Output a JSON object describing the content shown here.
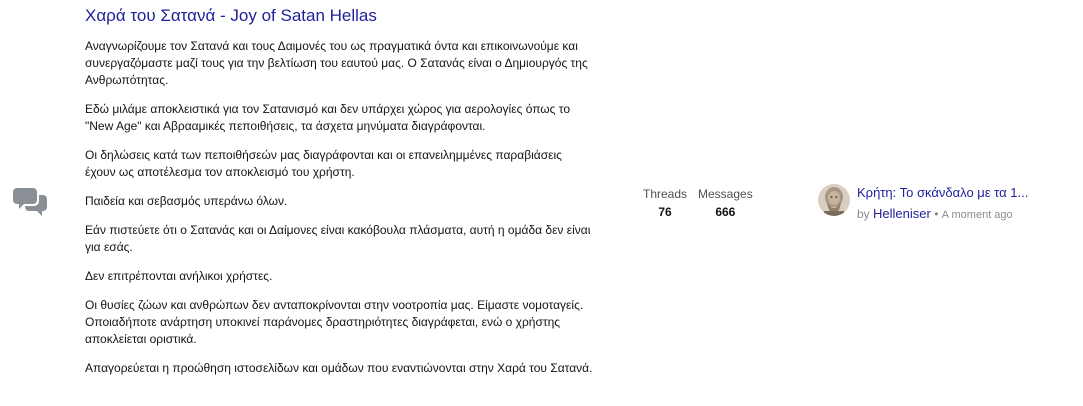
{
  "node": {
    "title": "Χαρά του Σατανά - Joy of Satan Hellas",
    "icon": "chat-bubbles-icon",
    "description": [
      "Αναγνωρίζουμε τον Σατανά και τους Δαιμονές του ως πραγματικά όντα και επικοινωνούμε και συνεργαζόμαστε μαζί τους για την βελτίωση του εαυτού μας. Ο Σατανάς είναι ο Δημιουργός της Ανθρωπότητας.",
      "Εδώ μιλάμε αποκλειστικά για τον Σατανισμό και δεν υπάρχει χώρος για αερολογίες όπως το \"New Age\" και Αβρααμικές πεποιθήσεις, τα άσχετα μηνύματα διαγράφονται.",
      "Οι δηλώσεις κατά των πεποιθήσεών μας διαγράφονται και οι επανειλημμένες παραβιάσεις έχουν ως αποτέλεσμα τον αποκλεισμό του χρήστη.",
      "Παιδεία και σεβασμός υπεράνω όλων.",
      "Εάν πιστεύετε ότι ο Σατανάς και οι Δαίμονες είναι κακόβουλα πλάσματα, αυτή η ομάδα δεν είναι για εσάς.",
      "Δεν επιτρέπονται ανήλικοι χρήστες.",
      "Οι θυσίες ζώων και ανθρώπων δεν ανταποκρίνονται στην νοοτροπία μας. Είμαστε νομοταγείς. Οποιαδήποτε ανάρτηση υποκινεί παράνομες δραστηριότητες διαγράφεται, ενώ ο χρήστης αποκλείεται οριστικά.",
      "Απαγορεύεται η προώθηση ιστοσελίδων και ομάδων που εναντιώνονται στην Χαρά του Σατανά."
    ],
    "stats": {
      "threads_label": "Threads",
      "threads_value": "76",
      "messages_label": "Messages",
      "messages_value": "666"
    },
    "last_post": {
      "title": "Κρήτη: Το σκάνδαλο με τα 1...",
      "by_label": "by",
      "user": "Helleniser",
      "separator": "•",
      "time": "A moment ago",
      "avatar_icon": "bust-statue-avatar"
    }
  },
  "colors": {
    "link": "#1f1f9a",
    "text": "#141414",
    "muted": "#8c8c8c",
    "icon": "#8a8f96"
  }
}
